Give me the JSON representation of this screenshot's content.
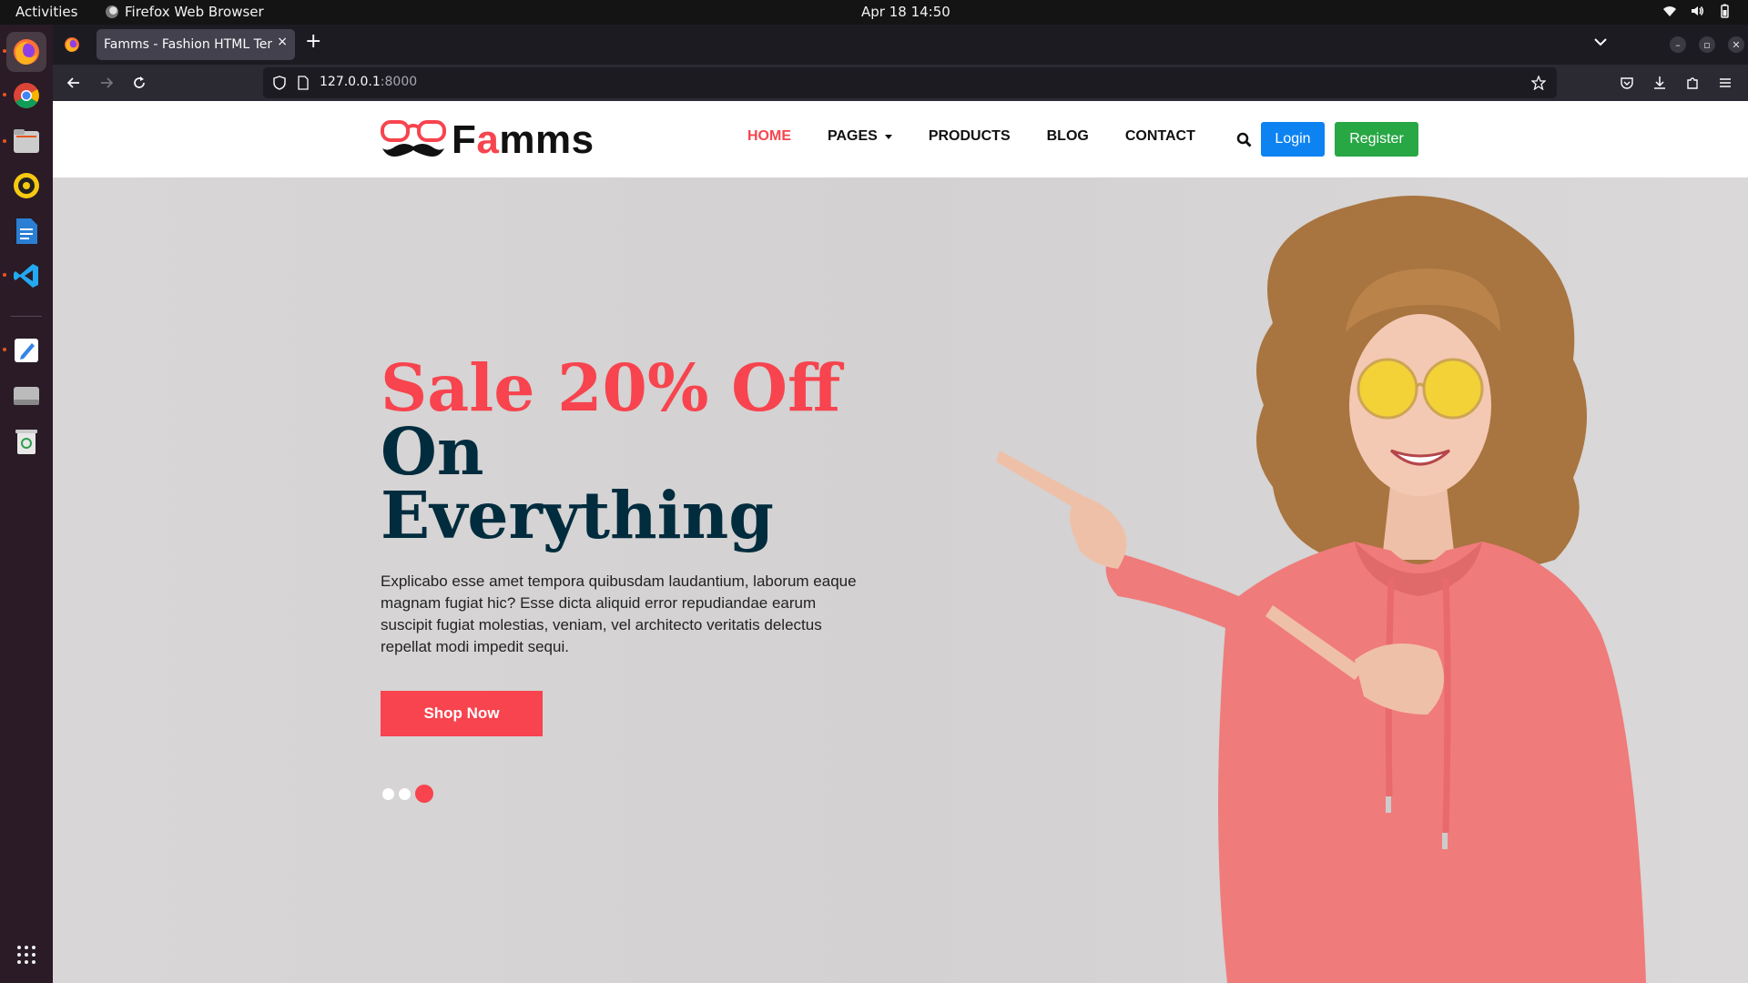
{
  "os": {
    "activities": "Activities",
    "app_name": "Firefox Web Browser",
    "datetime": "Apr 18  14:50"
  },
  "browser": {
    "tab_title": "Famms - Fashion HTML Temp",
    "tab_close": "×",
    "new_tab": "+",
    "url_host": "127.0.0.1",
    "url_port": ":8000"
  },
  "site": {
    "logo": {
      "text_main": "F",
      "text_accent": "a",
      "text_rest": "mms"
    },
    "nav": {
      "home": "HOME",
      "pages": "PAGES",
      "products": "PRODUCTS",
      "blog": "BLOG",
      "contact": "CONTACT"
    },
    "login": "Login",
    "register": "Register",
    "hero": {
      "title_red": "Sale 20% Off",
      "title_line2": "On",
      "title_line3": "Everything",
      "description": "Explicabo esse amet tempora quibusdam laudantium, laborum eaque magnam fugiat hic? Esse dicta aliquid error repudiandae earum suscipit fugiat molestias, veniam, vel architecto veritatis delectus repellat modi impedit sequi.",
      "cta": "Shop Now",
      "slides": 3,
      "active_slide": 3
    },
    "colors": {
      "accent": "#f7444e",
      "navy": "#002c3e",
      "login_blue": "#0d83f2",
      "register_green": "#28a745"
    }
  }
}
